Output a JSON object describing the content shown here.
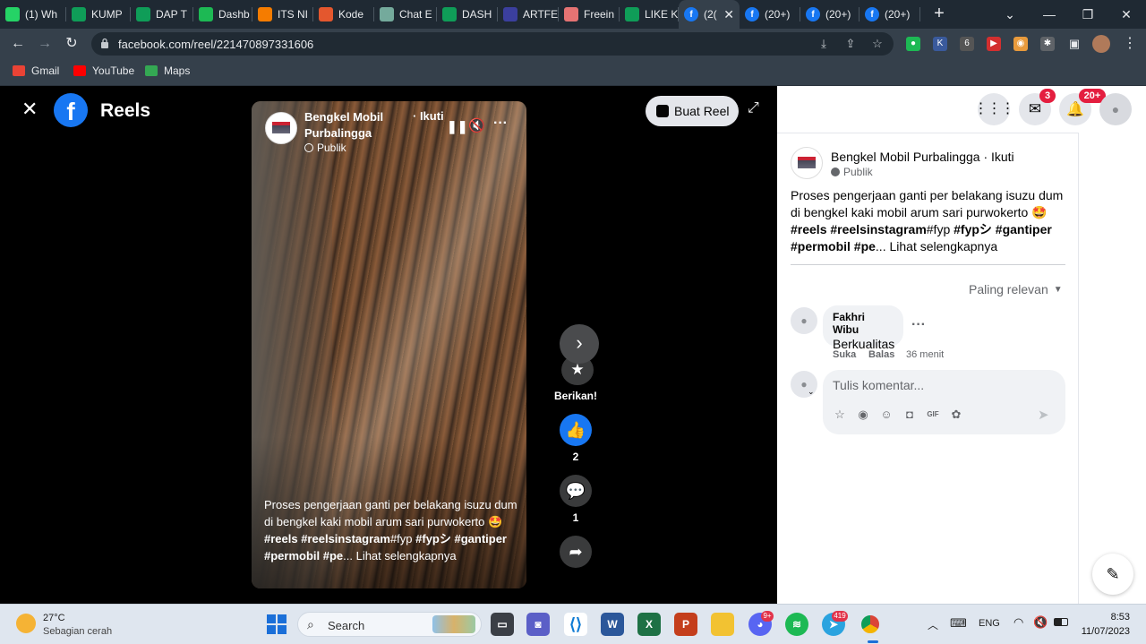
{
  "browser": {
    "tabs": [
      {
        "label": "(1) Wh",
        "icon": "whatsapp-icon",
        "color": "#25d366"
      },
      {
        "label": "KUMP",
        "icon": "sheets-icon",
        "color": "#0f9d58"
      },
      {
        "label": "DAP T",
        "icon": "sheets-icon",
        "color": "#0f9d58"
      },
      {
        "label": "Dashb",
        "icon": "dashboard-icon",
        "color": "#1db954"
      },
      {
        "label": "ITS NI",
        "icon": "hub-icon",
        "color": "#f57c00"
      },
      {
        "label": "Kode",
        "icon": "code-icon",
        "color": "#e4572e"
      },
      {
        "label": "Chat E",
        "icon": "chatgpt-icon",
        "color": "#74aa9c"
      },
      {
        "label": "DASH",
        "icon": "sheets-icon",
        "color": "#0f9d58"
      },
      {
        "label": "ARTFE",
        "icon": "artfe-icon",
        "color": "#3b3f9e"
      },
      {
        "label": "Freein",
        "icon": "freein-icon",
        "color": "#e57373"
      },
      {
        "label": "LIKE K",
        "icon": "sheets-icon",
        "color": "#0f9d58"
      },
      {
        "label": "(2(",
        "icon": "facebook-icon",
        "color": "#1877f2"
      },
      {
        "label": "(20+)",
        "icon": "facebook-icon",
        "color": "#1877f2"
      },
      {
        "label": "(20+)",
        "icon": "facebook-icon",
        "color": "#1877f2"
      },
      {
        "label": "(20+)",
        "icon": "facebook-icon",
        "color": "#1877f2"
      }
    ],
    "new_tab": "+",
    "url": "facebook.com/reel/221470897331606",
    "bookmarks": [
      {
        "label": "Gmail",
        "color": "#ea4335"
      },
      {
        "label": "YouTube",
        "color": "#ff0000"
      },
      {
        "label": "Maps",
        "color": "#34a853"
      }
    ],
    "extensions": [
      {
        "glyph": "●",
        "color": "#1db954"
      },
      {
        "glyph": "K",
        "color": "#3a5a9c"
      },
      {
        "glyph": "6",
        "color": "#555"
      },
      {
        "glyph": "▶",
        "color": "#d32f2f"
      },
      {
        "glyph": "◉",
        "color": "#e89a3c"
      },
      {
        "glyph": "✱",
        "color": "#5f6368"
      }
    ]
  },
  "reels": {
    "title": "Reels",
    "create_button": "Buat Reel",
    "video": {
      "page_name": "Bengkel Mobil\nPurbalingga",
      "follow": "· Ikuti",
      "privacy": "Publik",
      "caption_plain": "Proses pengerjaan ganti per belakang isuzu dum di bengkel kaki mobil arum sari purwokerto 🤩 ",
      "caption_tags1": "#reels #reelsinstagram",
      "caption_mid": "#fyp",
      "caption_tags2": "#fypシ #gantiper #permobil #pe",
      "caption_more": "... Lihat selengkapnya"
    },
    "actions": {
      "give_label": "Berikan!",
      "like_count": "2",
      "comment_count": "1"
    }
  },
  "panel": {
    "notif_messenger": "3",
    "notif_bell": "20+",
    "post": {
      "page_name": "Bengkel Mobil Purbalingga · Ikuti",
      "privacy": "Publik",
      "caption_plain": "Proses pengerjaan ganti per belakang isuzu dum di bengkel kaki mobil arum sari purwokerto 🤩",
      "tags_a": "#reels #reelsinstagram",
      "tags_b": "#fyp",
      "tags_c": "#fypシ #gantiper",
      "tags_d": "#permobil #pe",
      "more": "... Lihat selengkapnya"
    },
    "sort_label": "Paling relevan",
    "comment": {
      "author": "Fakhri Wibu",
      "text": "Berkualitas",
      "like": "Suka",
      "reply": "Balas",
      "time": "36 menit"
    },
    "input_placeholder": "Tulis komentar..."
  },
  "taskbar": {
    "weather_temp": "27°C",
    "weather_desc": "Sebagian cerah",
    "search_placeholder": "Search",
    "lang": "ENG",
    "time": "8:53",
    "date": "11/07/2023",
    "badge_discord": "9+",
    "badge_telegram": "419"
  }
}
